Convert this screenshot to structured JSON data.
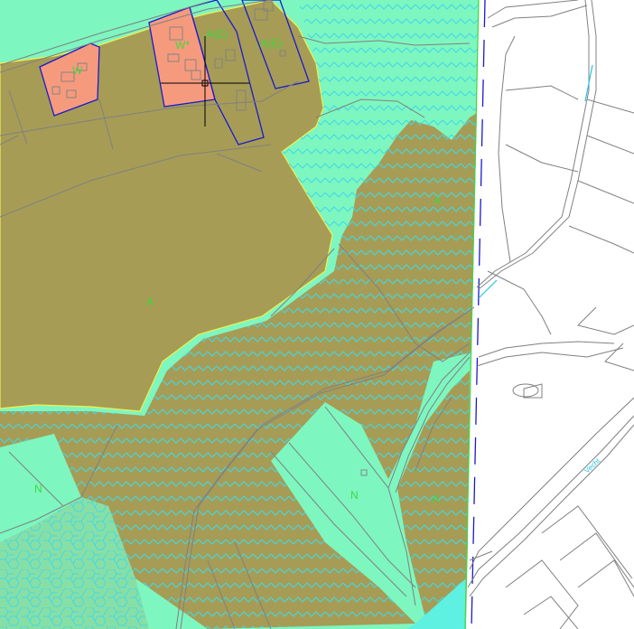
{
  "map": {
    "zone_labels": {
      "w_left": "W",
      "w_right": "W*",
      "a_e_1": "A(E)",
      "a_e_2": "A(E)",
      "a_centre": "A",
      "a_top_right": "A",
      "a_bottom_right": "A",
      "n_left": "N",
      "n_centre": "N"
    },
    "road_label": "Vecht"
  },
  "colors": {
    "agricultural": "#a69c56",
    "nature": "#7ef6c0",
    "residential": "#f69a7e",
    "zone_label": "#3fd83f",
    "water_hatch": "#3fd9e6",
    "boundary_blue": "#1a1acc",
    "boundary_yellow": "#f1f14a",
    "cadastral": "#808080",
    "road_label": "#20c8e0"
  }
}
